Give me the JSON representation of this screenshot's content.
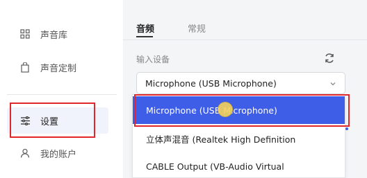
{
  "sidebar": {
    "items": [
      {
        "label": "声音库",
        "icon": "grid-icon"
      },
      {
        "label": "声音定制",
        "icon": "bag-icon"
      },
      {
        "label": "设置",
        "icon": "sliders-icon",
        "active": true
      },
      {
        "label": "我的账户",
        "icon": "user-icon"
      }
    ]
  },
  "tabs": [
    {
      "label": "音频",
      "active": true
    },
    {
      "label": "常规",
      "active": false
    }
  ],
  "input_device": {
    "label": "输入设备",
    "selected_value": "Microphone (USB Microphone)",
    "options": [
      {
        "label": "Microphone (USB Microphone)",
        "selected": true
      },
      {
        "label": "立体声混音 (Realtek High Definition"
      },
      {
        "label": "CABLE Output (VB-Audio Virtual"
      }
    ]
  },
  "colors": {
    "accent": "#3f5ee8",
    "highlight": "#e0262b",
    "main_bg": "#f4f5f7"
  }
}
